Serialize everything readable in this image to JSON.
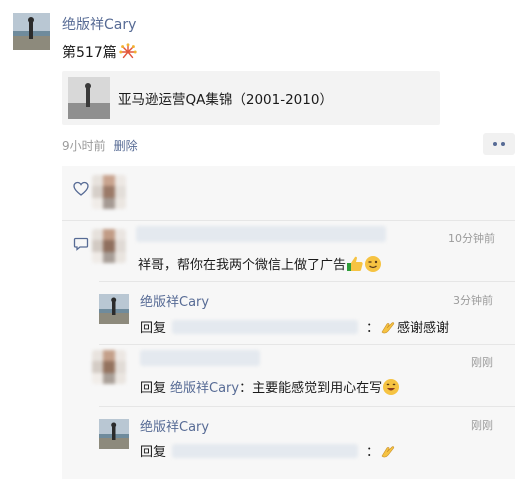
{
  "post": {
    "author": "绝版祥Cary",
    "text": "第517篇",
    "link_title": "亚马逊运营QA集锦（2001-2010）",
    "time": "9小时前",
    "delete_label": "删除"
  },
  "comments": [
    {
      "text": "祥哥，帮你在我两个微信上做了广告",
      "time": "10分钟前"
    },
    {
      "author": "绝版祥Cary",
      "reply_prefix": "回复",
      "colon": "：",
      "text": "感谢感谢",
      "time": "3分钟前"
    },
    {
      "reply_prefix": "回复",
      "reply_to": "绝版祥Cary",
      "text": "：主要能感觉到用心在写",
      "time": "刚刚"
    },
    {
      "author": "绝版祥Cary",
      "reply_prefix": "回复",
      "colon": "：",
      "time": "刚刚"
    }
  ],
  "colors": {
    "link_blue": "#576b95",
    "comment_bg": "#f7f7f7",
    "time_gray": "#9b9b9b"
  },
  "icons": {
    "like": "heart-outline-icon",
    "comment": "comment-bubble-icon",
    "more": "more-dots-icon"
  }
}
